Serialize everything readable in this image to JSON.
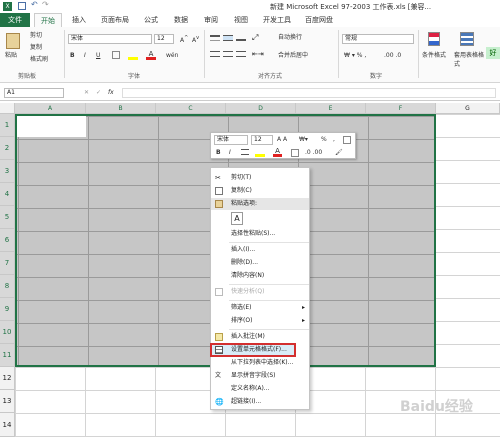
{
  "title": "新建 Microsoft Excel 97-2003 工作表.xls  [兼容...",
  "tabs": [
    "文件",
    "开始",
    "插入",
    "页面布局",
    "公式",
    "数据",
    "审阅",
    "视图",
    "开发工具",
    "百度网盘"
  ],
  "ribbon": {
    "paste": "粘贴",
    "cut": "剪切",
    "copy": "复制",
    "format_painter": "格式刷",
    "font_name": "宋体",
    "font_size": "12",
    "bold": "B",
    "italic": "I",
    "underline": "U",
    "wrap": "自动换行",
    "merge": "合并后居中",
    "number_format": "常规",
    "cond": "条件格式",
    "table_fmt": "套用表格格式",
    "good": "好",
    "groups": [
      "剪贴板",
      "字体",
      "对齐方式",
      "数字"
    ]
  },
  "formula": {
    "namebox": "A1",
    "fx": "fx"
  },
  "columns": [
    "A",
    "B",
    "C",
    "D",
    "E",
    "F",
    "G"
  ],
  "rows": [
    "1",
    "2",
    "3",
    "4",
    "5",
    "6",
    "7",
    "8",
    "9",
    "10",
    "11",
    "12",
    "13",
    "14"
  ],
  "minibar": {
    "font": "宋体",
    "size": "12",
    "pct": "%",
    "bold": "B",
    "italic": "I"
  },
  "context_menu": {
    "items": [
      "剪切(T)",
      "复制(C)",
      "粘贴选项:",
      "选择性粘贴(S)...",
      "插入(I)...",
      "删除(D)...",
      "清除内容(N)",
      "快速分析(Q)",
      "筛选(E)",
      "排序(O)",
      "插入批注(M)",
      "设置单元格格式(F)...",
      "从下拉列表中选择(K)...",
      "显示拼音字段(S)",
      "定义名称(A)...",
      "超链接(I)..."
    ]
  },
  "colors": {
    "excel_green": "#217346",
    "selection": "#c6c6c6",
    "highlight": "#d32f2f"
  },
  "watermark": "Baidu经验"
}
